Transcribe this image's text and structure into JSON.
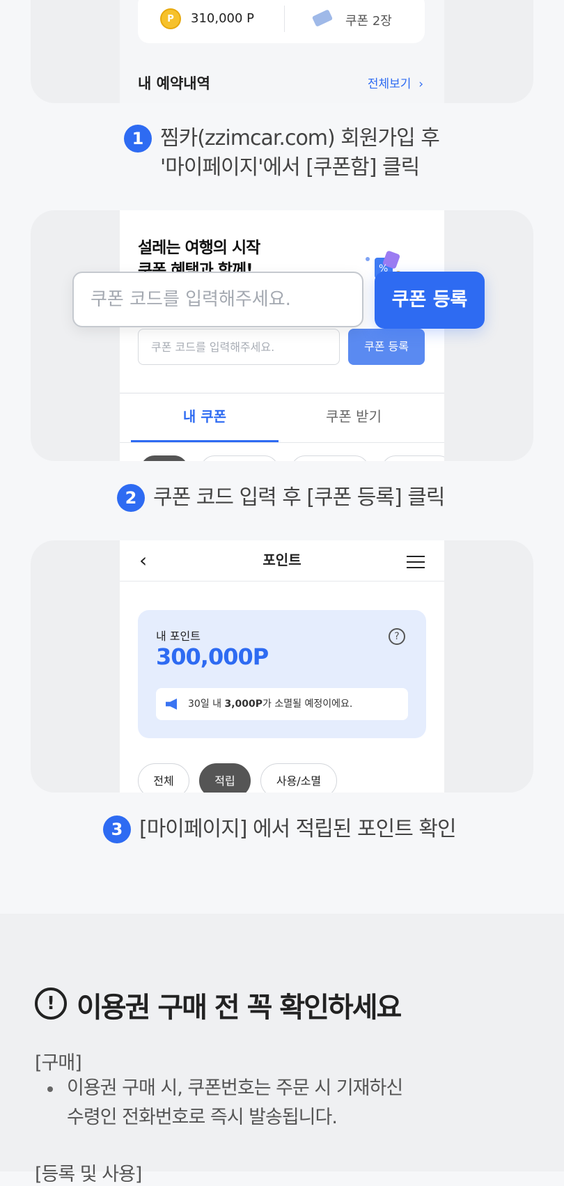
{
  "card1": {
    "point_value": "310,000 P",
    "coupon_count": "쿠폰 2장",
    "reservation_title": "내 예약내역",
    "view_all": "전체보기"
  },
  "step1": {
    "number": "1",
    "line1": "찜카(zzimcar.com) 회원가입 후",
    "line2": "'마이페이지'에서 [쿠폰함] 클릭"
  },
  "card2": {
    "headline_line1": "설레는 여행의 시작",
    "headline_line2": "쿠폰 혜택과 함께!",
    "small_placeholder": "쿠폰 코드를 입력해주세요.",
    "small_button": "쿠폰 등록",
    "tab_my_coupons": "내 쿠폰",
    "tab_get_coupons": "쿠폰 받기",
    "big_placeholder": "쿠폰 코드를 입력해주세요.",
    "big_button": "쿠폰 등록"
  },
  "step2": {
    "number": "2",
    "line1": "쿠폰 코드 입력 후 [쿠폰 등록] 클릭"
  },
  "card3": {
    "title": "포인트",
    "my_points_label": "내 포인트",
    "my_points_value": "300,000P",
    "notice_prefix": "30일 내 ",
    "notice_bold": "3,000P",
    "notice_suffix": "가 소멸될 예정이에요.",
    "filter_all": "전체",
    "filter_earn": "적립",
    "filter_use": "사용/소멸"
  },
  "step3": {
    "number": "3",
    "line1": "[마이페이지] 에서 적립된 포인트 확인"
  },
  "notice_section": {
    "title": "이용권 구매 전 꼭 확인하세요",
    "purchase_label": "[구매]",
    "purchase_line1": "이용권 구매 시, 쿠폰번호는 주문 시 기재하신",
    "purchase_line2": "수령인 전화번호로 즉시 발송됩니다.",
    "next_label": "[등록 및 사용]"
  },
  "colors": {
    "accent": "#2e6bf2",
    "background": "#f6f7f9",
    "card": "#eeeff1"
  }
}
